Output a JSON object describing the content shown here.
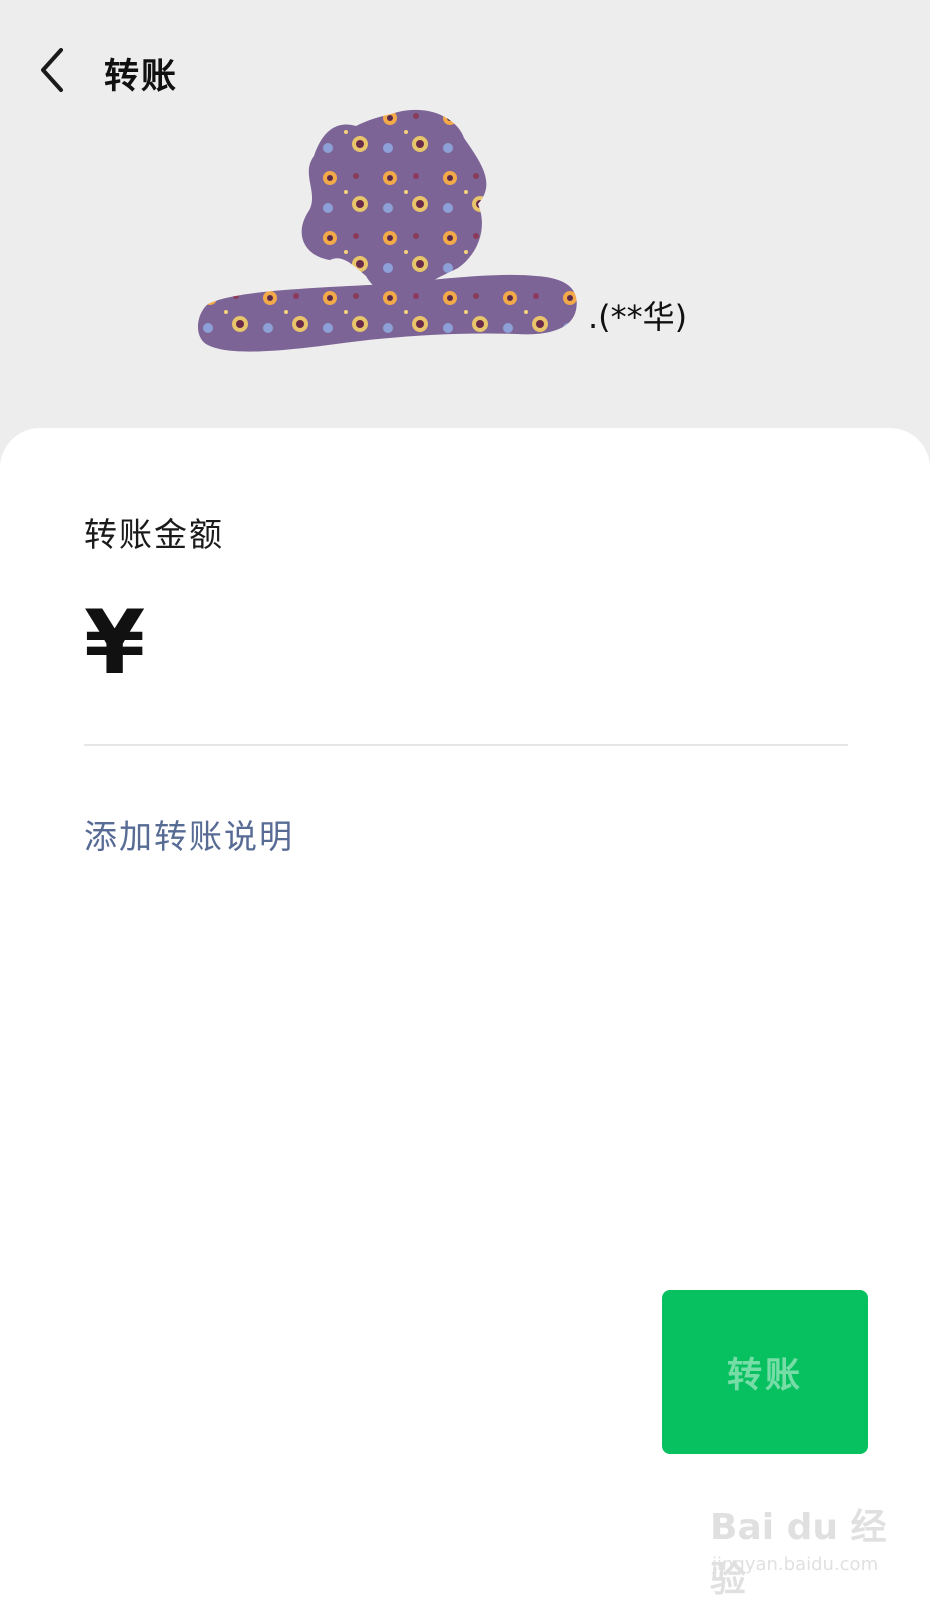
{
  "header": {
    "title": "转账",
    "back_icon": "chevron-left-icon"
  },
  "recipient": {
    "name_suffix": "(**华)"
  },
  "transfer": {
    "amount_label": "转账金额",
    "currency_symbol": "¥",
    "amount_value": "",
    "add_note_label": "添加转账说明",
    "submit_label": "转账"
  },
  "watermark": {
    "brand": "Bai du 经验",
    "url": "jingyan.baidu.com"
  },
  "colors": {
    "background": "#ededed",
    "card": "#ffffff",
    "accent_green": "#07c160",
    "link_blue": "#576b95",
    "scribble_purple": "#7d6496"
  }
}
